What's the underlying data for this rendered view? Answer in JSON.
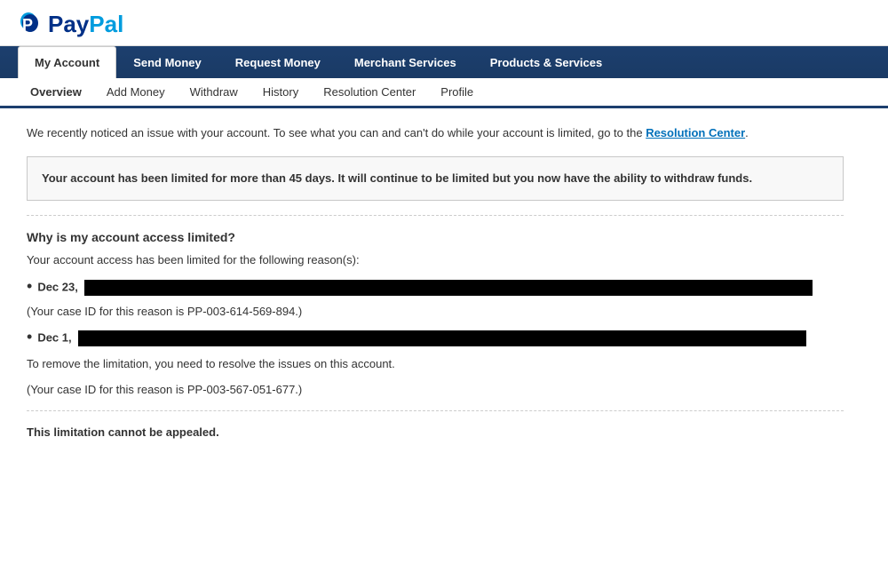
{
  "header": {
    "logo_pay": "Pay",
    "logo_pal": "Pal"
  },
  "main_nav": {
    "tabs": [
      {
        "id": "my-account",
        "label": "My Account",
        "active": true
      },
      {
        "id": "send-money",
        "label": "Send Money",
        "active": false
      },
      {
        "id": "request-money",
        "label": "Request Money",
        "active": false
      },
      {
        "id": "merchant-services",
        "label": "Merchant Services",
        "active": false
      },
      {
        "id": "products-services",
        "label": "Products & Services",
        "active": false
      }
    ]
  },
  "sub_nav": {
    "items": [
      {
        "id": "overview",
        "label": "Overview",
        "active": true
      },
      {
        "id": "add-money",
        "label": "Add Money",
        "active": false
      },
      {
        "id": "withdraw",
        "label": "Withdraw",
        "active": false
      },
      {
        "id": "history",
        "label": "History",
        "active": false
      },
      {
        "id": "resolution-center",
        "label": "Resolution Center",
        "active": false
      },
      {
        "id": "profile",
        "label": "Profile",
        "active": false
      }
    ]
  },
  "content": {
    "notice": "We recently noticed an issue with your account. To see what you can and can't do while your account is limited, go to the",
    "notice_link": "Resolution Center",
    "notice_end": ".",
    "warning_text": "Your account has been limited for more than 45 days. It will continue to be limited but you now have the ability to withdraw funds.",
    "why_title": "Why is my account access limited?",
    "why_intro": "Your account access has been limited for the following reason(s):",
    "reason1_date": "Dec 23,",
    "reason1_case": "(Your case ID for this reason is PP-003-614-569-894.)",
    "reason2_date": "Dec 1,",
    "resolve_text": "To remove the limitation, you need to resolve the issues on this account.",
    "reason2_case": "(Your case ID for this reason is PP-003-567-051-677.)",
    "appeal_text": "This limitation cannot be appealed."
  }
}
